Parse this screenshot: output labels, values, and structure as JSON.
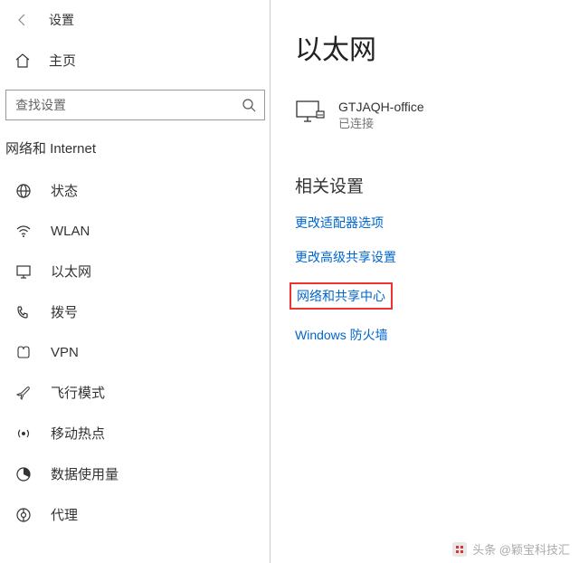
{
  "header": {
    "title": "设置"
  },
  "home": {
    "label": "主页"
  },
  "search": {
    "placeholder": "查找设置"
  },
  "sidebar": {
    "section_title": "网络和 Internet",
    "items": [
      {
        "label": "状态"
      },
      {
        "label": "WLAN"
      },
      {
        "label": "以太网"
      },
      {
        "label": "拨号"
      },
      {
        "label": "VPN"
      },
      {
        "label": "飞行模式"
      },
      {
        "label": "移动热点"
      },
      {
        "label": "数据使用量"
      },
      {
        "label": "代理"
      }
    ]
  },
  "main": {
    "title": "以太网",
    "network": {
      "name": "GTJAQH-office",
      "status": "已连接"
    },
    "related_title": "相关设置",
    "links": [
      {
        "label": "更改适配器选项"
      },
      {
        "label": "更改高级共享设置"
      },
      {
        "label": "网络和共享中心"
      },
      {
        "label": "Windows 防火墙"
      }
    ]
  },
  "watermark": {
    "text": "头条 @颖宝科技汇"
  }
}
